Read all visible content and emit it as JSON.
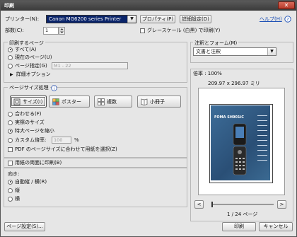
{
  "window": {
    "title": "印刷",
    "close_glyph": "✕"
  },
  "printer": {
    "label": "プリンター(N):",
    "value": "Canon MG6200 series Printer",
    "properties_label": "プロパティ(P)",
    "advanced_label": "詳細設定(D)",
    "help_label": "ヘルプ(H)"
  },
  "copies": {
    "label": "部数(C):",
    "value": "1",
    "grayscale_label": "グレースケール (白黒) で印刷(Y)"
  },
  "pages": {
    "title": "印刷するページ",
    "all": "すべて(A)",
    "current": "現在のページ(U)",
    "range": "ページ指定(G)",
    "range_value": "M1 - 22",
    "more": "詳細オプション"
  },
  "sizing": {
    "title": "ページサイズ処理",
    "size": "サイズ(I)",
    "poster": "ポスター",
    "multiple": "複数",
    "booklet": "小冊子",
    "fit": "合わせる(F)",
    "actual": "実際のサイズ",
    "shrink": "特大ページを縮小",
    "custom": "カスタム倍率:",
    "custom_value": "100",
    "percent": "%",
    "pdf_paper": "PDF のページサイズに合わせて用紙を選択(Z)"
  },
  "duplex": {
    "label": "用紙の両面に印刷(B)"
  },
  "orientation": {
    "title": "向き:",
    "auto": "自動縦 / 横(R)",
    "portrait": "縦",
    "landscape": "横"
  },
  "annotations": {
    "title": "注釈とフォーム(M)",
    "value": "文書と注釈"
  },
  "preview": {
    "zoom": "倍率 : 100%",
    "dims": "209.97 x 296.97 ミリ",
    "brand": "FOMA SH901iC",
    "page": "1 / 24 ページ",
    "prev": "<",
    "next": ">"
  },
  "footer": {
    "page_setup": "ページ設定(S)...",
    "print": "印刷",
    "cancel": "キャンセル"
  },
  "colors": {
    "accent_selection": "#0a246a",
    "link": "#1b4fb5",
    "phone_bg": "#2f5d88"
  }
}
